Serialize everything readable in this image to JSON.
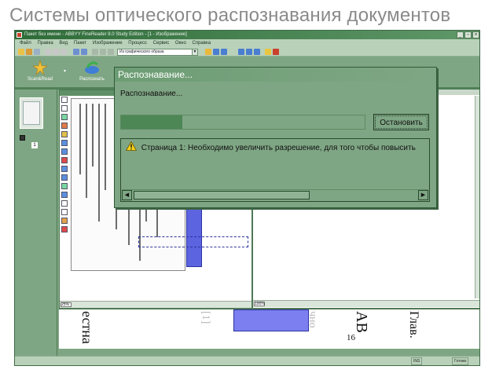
{
  "slide": {
    "title": "Системы оптического распознавания документов"
  },
  "app": {
    "title": "Пакет без имени - ABBYY FineReader 8.0 Study Edition - [1 - Изображение]",
    "window_controls": [
      "_",
      "▫",
      "×"
    ],
    "menu": [
      "Файл",
      "Правка",
      "Вид",
      "Пакет",
      "Изображение",
      "Процесс",
      "Сервис",
      "Окно",
      "Справка"
    ],
    "toolbar_combo": "Из графического образа",
    "big_buttons": [
      {
        "label": "Scan&Read"
      },
      {
        "label": "Распознать"
      }
    ],
    "page_number": "1",
    "image_zoom": "25%",
    "text_zoom": "100%",
    "status": [
      "INS",
      "Готово"
    ],
    "zoom_text": [
      "естна",
      "[1]",
      "чно",
      "АВ",
      "16",
      "Глав."
    ]
  },
  "dialog": {
    "title": "Распознавание...",
    "label": "Распознавание...",
    "progress_fraction": 0.25,
    "stop_button": "Остановить",
    "message": "Страница 1: Необходимо увеличить разрешение, для того чтобы повысить"
  }
}
